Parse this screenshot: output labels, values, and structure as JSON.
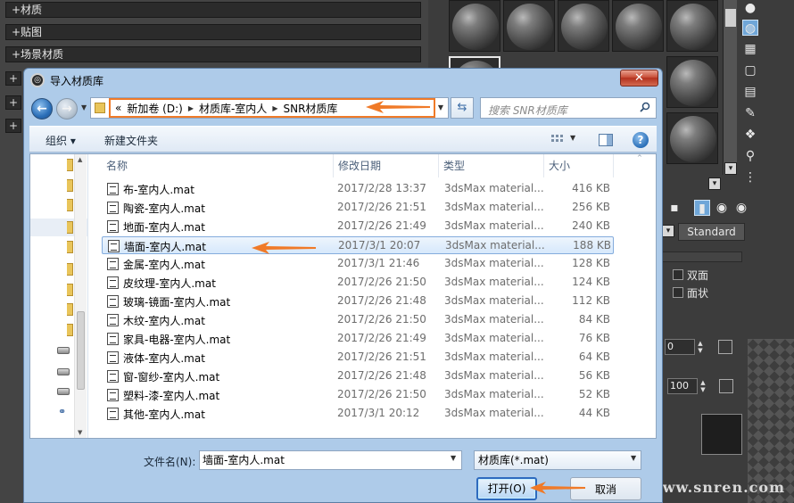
{
  "max_panel": {
    "rollouts": [
      {
        "label": "材质"
      },
      {
        "label": "贴图"
      },
      {
        "label": "场景材质"
      }
    ],
    "standard_label": "Standard",
    "double_sided_label": "双面",
    "faceted_label": "面状",
    "spinner_1_value": "0",
    "spinner_2_value": "100",
    "watermark": "www.snren.com"
  },
  "dialog": {
    "title": "导入材质库",
    "close_label": "✕",
    "address": {
      "lead": "«",
      "crumbs": [
        "新加卷 (D:)",
        "材质库-室内人",
        "SNR材质库"
      ]
    },
    "search_placeholder": "搜索 SNR材质库",
    "toolbar": {
      "organize": "组织 ▾",
      "new_folder": "新建文件夹"
    },
    "columns": {
      "name": "名称",
      "modified": "修改日期",
      "type": "类型",
      "size": "大小"
    },
    "files": [
      {
        "name": "布-室内人.mat",
        "date": "2017/2/28 13:37",
        "type": "3dsMax material...",
        "size": "416 KB"
      },
      {
        "name": "陶瓷-室内人.mat",
        "date": "2017/2/26 21:51",
        "type": "3dsMax material...",
        "size": "256 KB"
      },
      {
        "name": "地面-室内人.mat",
        "date": "2017/2/26 21:49",
        "type": "3dsMax material...",
        "size": "240 KB"
      },
      {
        "name": "墙面-室内人.mat",
        "date": "2017/3/1 20:07",
        "type": "3dsMax material...",
        "size": "188 KB"
      },
      {
        "name": "金属-室内人.mat",
        "date": "2017/3/1 21:46",
        "type": "3dsMax material...",
        "size": "128 KB"
      },
      {
        "name": "皮纹理-室内人.mat",
        "date": "2017/2/26 21:50",
        "type": "3dsMax material...",
        "size": "124 KB"
      },
      {
        "name": "玻璃-镜面-室内人.mat",
        "date": "2017/2/26 21:48",
        "type": "3dsMax material...",
        "size": "112 KB"
      },
      {
        "name": "木纹-室内人.mat",
        "date": "2017/2/26 21:50",
        "type": "3dsMax material...",
        "size": "84 KB"
      },
      {
        "name": "家具-电器-室内人.mat",
        "date": "2017/2/26 21:49",
        "type": "3dsMax material...",
        "size": "76 KB"
      },
      {
        "name": "液体-室内人.mat",
        "date": "2017/2/26 21:51",
        "type": "3dsMax material...",
        "size": "64 KB"
      },
      {
        "name": "窗-窗纱-室内人.mat",
        "date": "2017/2/26 21:48",
        "type": "3dsMax material...",
        "size": "56 KB"
      },
      {
        "name": "塑料-漆-室内人.mat",
        "date": "2017/2/26 21:50",
        "type": "3dsMax material...",
        "size": "52 KB"
      },
      {
        "name": "其他-室内人.mat",
        "date": "2017/3/1 20:12",
        "type": "3dsMax material...",
        "size": "44 KB"
      }
    ],
    "selected_index": 3,
    "filename_label": "文件名(N):",
    "filename_value": "墙面-室内人.mat",
    "filetype_value": "材质库(*.mat)",
    "open_label": "打开(O)",
    "cancel_label": "取消"
  },
  "colors": {
    "annotation_arrow": "#f07a28",
    "selection_border": "#84acdd",
    "dialog_frame": "#aecbe9"
  }
}
